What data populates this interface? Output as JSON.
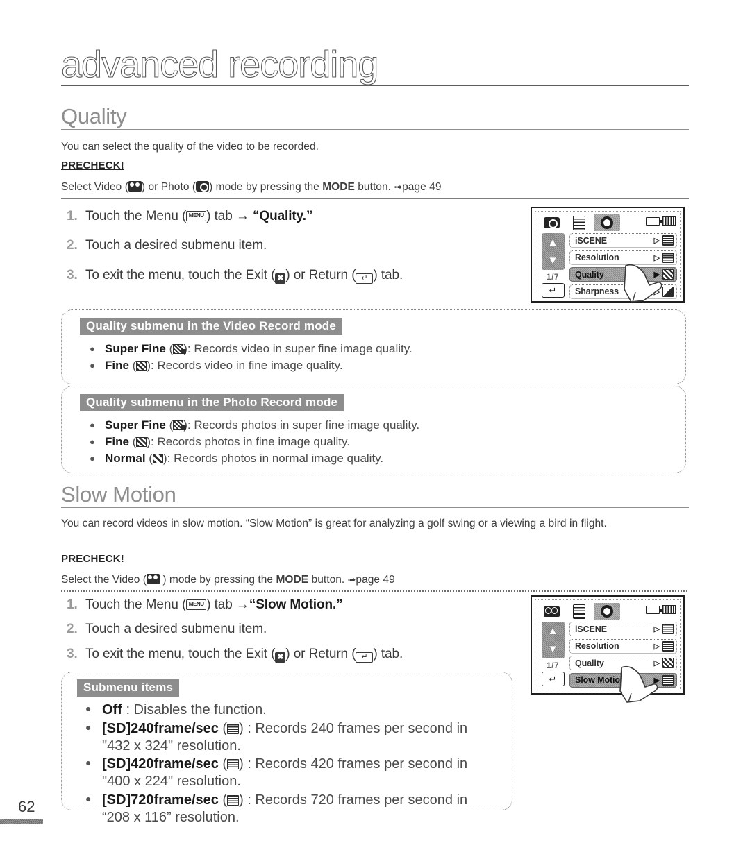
{
  "page": {
    "title": "advanced recording",
    "number": "62"
  },
  "quality": {
    "heading": "Quality",
    "intro": "You can select the quality of the video to be recorded.",
    "precheck_label": "PRECHECK!",
    "precheck_pre": "Select Video (",
    "precheck_mid": ") or Photo (",
    "precheck_post": ") mode by pressing the ",
    "precheck_mode": "MODE",
    "precheck_tail": " button. ",
    "precheck_page": "page 49",
    "steps": [
      {
        "num": "1.",
        "pre": "Touch the Menu (",
        "mid": ") tab ",
        "arrow": "→",
        "strong": " “Quality.”"
      },
      {
        "num": "2.",
        "text": "Touch a desired submenu item."
      },
      {
        "num": "3.",
        "pre": "To exit the menu, touch the Exit (",
        "mid": ") or Return (",
        "post": ") tab."
      }
    ],
    "video_box": {
      "header": "Quality submenu in the Video Record mode",
      "items": [
        {
          "name": "Super Fine",
          "icon": "quality-superfine-icon",
          "desc": ": Records video in super fine image quality."
        },
        {
          "name": "Fine",
          "icon": "quality-fine-icon",
          "desc": ": Records video in fine image quality."
        }
      ]
    },
    "photo_box": {
      "header": "Quality submenu in the Photo Record mode",
      "items": [
        {
          "name": "Super Fine",
          "icon": "quality-superfine-icon",
          "desc": ": Records photos in super fine image quality."
        },
        {
          "name": "Fine",
          "icon": "quality-fine-icon",
          "desc": ": Records photos in fine image quality."
        },
        {
          "name": "Normal",
          "icon": "quality-normal-icon",
          "desc": ": Records photos in normal image quality."
        }
      ]
    },
    "lcd": {
      "mode_tab_icon": "photo-mode-icon",
      "page_indicator": "1/7",
      "rows": [
        {
          "label": "iSCENE",
          "icon": "iscene-value-icon",
          "selected": false
        },
        {
          "label": "Resolution",
          "icon": "resolution-value-icon",
          "selected": false
        },
        {
          "label": "Quality",
          "icon": "quality-value-icon",
          "selected": true
        },
        {
          "label": "Sharpness",
          "icon": "sharpness-value-icon",
          "selected": false
        }
      ]
    }
  },
  "slow_motion": {
    "heading": "Slow Motion",
    "intro": "You can record videos in slow motion. “Slow Motion” is great for analyzing a golf swing or a viewing a bird in flight.",
    "precheck_label": "PRECHECK!",
    "precheck_pre": "Select the Video (",
    "precheck_post": " ) mode by pressing the ",
    "precheck_mode": "MODE",
    "precheck_tail": " button. ",
    "precheck_page": "page 49",
    "steps": [
      {
        "num": "1.",
        "pre": "Touch the Menu (",
        "mid": ") tab ",
        "arrow": "→",
        "strong": "“Slow Motion.”"
      },
      {
        "num": "2.",
        "text": "Touch a desired submenu item."
      },
      {
        "num": "3.",
        "pre": "To exit the menu, touch the Exit (",
        "mid": ") or Return (",
        "post": ") tab."
      }
    ],
    "submenu_box": {
      "header": "Submenu items",
      "items": [
        {
          "name": "Off",
          "has_icon": false,
          "desc": " : Disables the function.",
          "line2": ""
        },
        {
          "name": "[SD]240frame/sec",
          "has_icon": true,
          "icon": "fps-240-icon",
          "desc": " : Records 240 frames per second in",
          "line2": "\"432 x 324\" resolution."
        },
        {
          "name": "[SD]420frame/sec",
          "has_icon": true,
          "icon": "fps-420-icon",
          "desc": " : Records 420 frames per second in",
          "line2": "\"400 x 224\" resolution."
        },
        {
          "name": "[SD]720frame/sec",
          "has_icon": true,
          "icon": "fps-720-icon",
          "desc": " : Records 720 frames per second in",
          "line2": "“208 x 116” resolution."
        }
      ]
    },
    "lcd": {
      "mode_tab_icon": "video-mode-icon",
      "page_indicator": "1/7",
      "rows": [
        {
          "label": "iSCENE",
          "icon": "iscene-value-icon",
          "selected": false
        },
        {
          "label": "Resolution",
          "icon": "resolution-value-icon",
          "selected": false
        },
        {
          "label": "Quality",
          "icon": "quality-value-icon",
          "selected": false
        },
        {
          "label": "Slow Motion",
          "icon": "slowmotion-value-icon",
          "selected": true
        }
      ]
    }
  }
}
